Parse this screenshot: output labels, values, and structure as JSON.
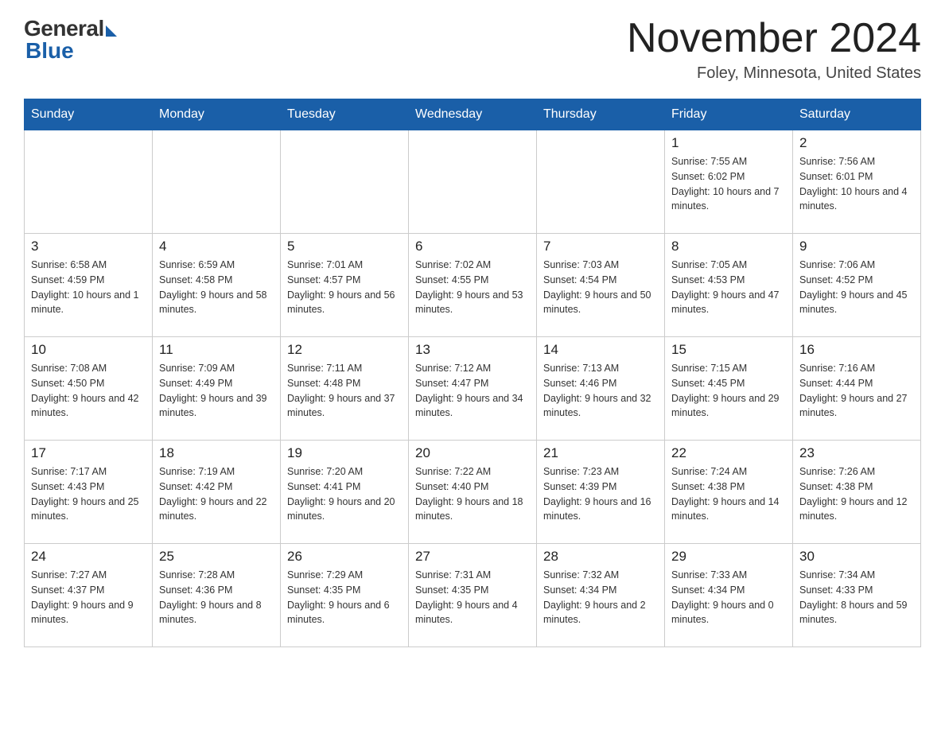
{
  "header": {
    "logo_general": "General",
    "logo_blue": "Blue",
    "month_title": "November 2024",
    "location": "Foley, Minnesota, United States"
  },
  "calendar": {
    "days_of_week": [
      "Sunday",
      "Monday",
      "Tuesday",
      "Wednesday",
      "Thursday",
      "Friday",
      "Saturday"
    ],
    "weeks": [
      [
        {
          "day": "",
          "sunrise": "",
          "sunset": "",
          "daylight": ""
        },
        {
          "day": "",
          "sunrise": "",
          "sunset": "",
          "daylight": ""
        },
        {
          "day": "",
          "sunrise": "",
          "sunset": "",
          "daylight": ""
        },
        {
          "day": "",
          "sunrise": "",
          "sunset": "",
          "daylight": ""
        },
        {
          "day": "",
          "sunrise": "",
          "sunset": "",
          "daylight": ""
        },
        {
          "day": "1",
          "sunrise": "Sunrise: 7:55 AM",
          "sunset": "Sunset: 6:02 PM",
          "daylight": "Daylight: 10 hours and 7 minutes."
        },
        {
          "day": "2",
          "sunrise": "Sunrise: 7:56 AM",
          "sunset": "Sunset: 6:01 PM",
          "daylight": "Daylight: 10 hours and 4 minutes."
        }
      ],
      [
        {
          "day": "3",
          "sunrise": "Sunrise: 6:58 AM",
          "sunset": "Sunset: 4:59 PM",
          "daylight": "Daylight: 10 hours and 1 minute."
        },
        {
          "day": "4",
          "sunrise": "Sunrise: 6:59 AM",
          "sunset": "Sunset: 4:58 PM",
          "daylight": "Daylight: 9 hours and 58 minutes."
        },
        {
          "day": "5",
          "sunrise": "Sunrise: 7:01 AM",
          "sunset": "Sunset: 4:57 PM",
          "daylight": "Daylight: 9 hours and 56 minutes."
        },
        {
          "day": "6",
          "sunrise": "Sunrise: 7:02 AM",
          "sunset": "Sunset: 4:55 PM",
          "daylight": "Daylight: 9 hours and 53 minutes."
        },
        {
          "day": "7",
          "sunrise": "Sunrise: 7:03 AM",
          "sunset": "Sunset: 4:54 PM",
          "daylight": "Daylight: 9 hours and 50 minutes."
        },
        {
          "day": "8",
          "sunrise": "Sunrise: 7:05 AM",
          "sunset": "Sunset: 4:53 PM",
          "daylight": "Daylight: 9 hours and 47 minutes."
        },
        {
          "day": "9",
          "sunrise": "Sunrise: 7:06 AM",
          "sunset": "Sunset: 4:52 PM",
          "daylight": "Daylight: 9 hours and 45 minutes."
        }
      ],
      [
        {
          "day": "10",
          "sunrise": "Sunrise: 7:08 AM",
          "sunset": "Sunset: 4:50 PM",
          "daylight": "Daylight: 9 hours and 42 minutes."
        },
        {
          "day": "11",
          "sunrise": "Sunrise: 7:09 AM",
          "sunset": "Sunset: 4:49 PM",
          "daylight": "Daylight: 9 hours and 39 minutes."
        },
        {
          "day": "12",
          "sunrise": "Sunrise: 7:11 AM",
          "sunset": "Sunset: 4:48 PM",
          "daylight": "Daylight: 9 hours and 37 minutes."
        },
        {
          "day": "13",
          "sunrise": "Sunrise: 7:12 AM",
          "sunset": "Sunset: 4:47 PM",
          "daylight": "Daylight: 9 hours and 34 minutes."
        },
        {
          "day": "14",
          "sunrise": "Sunrise: 7:13 AM",
          "sunset": "Sunset: 4:46 PM",
          "daylight": "Daylight: 9 hours and 32 minutes."
        },
        {
          "day": "15",
          "sunrise": "Sunrise: 7:15 AM",
          "sunset": "Sunset: 4:45 PM",
          "daylight": "Daylight: 9 hours and 29 minutes."
        },
        {
          "day": "16",
          "sunrise": "Sunrise: 7:16 AM",
          "sunset": "Sunset: 4:44 PM",
          "daylight": "Daylight: 9 hours and 27 minutes."
        }
      ],
      [
        {
          "day": "17",
          "sunrise": "Sunrise: 7:17 AM",
          "sunset": "Sunset: 4:43 PM",
          "daylight": "Daylight: 9 hours and 25 minutes."
        },
        {
          "day": "18",
          "sunrise": "Sunrise: 7:19 AM",
          "sunset": "Sunset: 4:42 PM",
          "daylight": "Daylight: 9 hours and 22 minutes."
        },
        {
          "day": "19",
          "sunrise": "Sunrise: 7:20 AM",
          "sunset": "Sunset: 4:41 PM",
          "daylight": "Daylight: 9 hours and 20 minutes."
        },
        {
          "day": "20",
          "sunrise": "Sunrise: 7:22 AM",
          "sunset": "Sunset: 4:40 PM",
          "daylight": "Daylight: 9 hours and 18 minutes."
        },
        {
          "day": "21",
          "sunrise": "Sunrise: 7:23 AM",
          "sunset": "Sunset: 4:39 PM",
          "daylight": "Daylight: 9 hours and 16 minutes."
        },
        {
          "day": "22",
          "sunrise": "Sunrise: 7:24 AM",
          "sunset": "Sunset: 4:38 PM",
          "daylight": "Daylight: 9 hours and 14 minutes."
        },
        {
          "day": "23",
          "sunrise": "Sunrise: 7:26 AM",
          "sunset": "Sunset: 4:38 PM",
          "daylight": "Daylight: 9 hours and 12 minutes."
        }
      ],
      [
        {
          "day": "24",
          "sunrise": "Sunrise: 7:27 AM",
          "sunset": "Sunset: 4:37 PM",
          "daylight": "Daylight: 9 hours and 9 minutes."
        },
        {
          "day": "25",
          "sunrise": "Sunrise: 7:28 AM",
          "sunset": "Sunset: 4:36 PM",
          "daylight": "Daylight: 9 hours and 8 minutes."
        },
        {
          "day": "26",
          "sunrise": "Sunrise: 7:29 AM",
          "sunset": "Sunset: 4:35 PM",
          "daylight": "Daylight: 9 hours and 6 minutes."
        },
        {
          "day": "27",
          "sunrise": "Sunrise: 7:31 AM",
          "sunset": "Sunset: 4:35 PM",
          "daylight": "Daylight: 9 hours and 4 minutes."
        },
        {
          "day": "28",
          "sunrise": "Sunrise: 7:32 AM",
          "sunset": "Sunset: 4:34 PM",
          "daylight": "Daylight: 9 hours and 2 minutes."
        },
        {
          "day": "29",
          "sunrise": "Sunrise: 7:33 AM",
          "sunset": "Sunset: 4:34 PM",
          "daylight": "Daylight: 9 hours and 0 minutes."
        },
        {
          "day": "30",
          "sunrise": "Sunrise: 7:34 AM",
          "sunset": "Sunset: 4:33 PM",
          "daylight": "Daylight: 8 hours and 59 minutes."
        }
      ]
    ]
  }
}
